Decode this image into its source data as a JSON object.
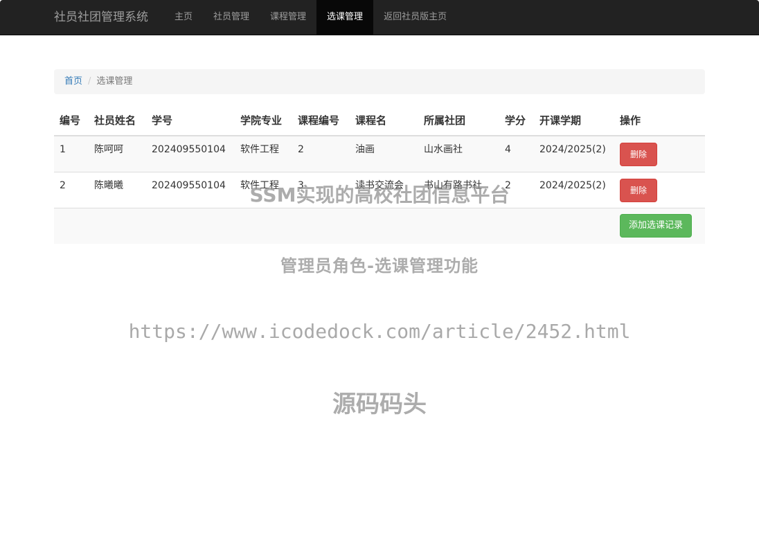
{
  "navbar": {
    "brand": "社员社团管理系统",
    "items": [
      {
        "label": "主页",
        "active": false
      },
      {
        "label": "社员管理",
        "active": false
      },
      {
        "label": "课程管理",
        "active": false
      },
      {
        "label": "选课管理",
        "active": true
      },
      {
        "label": "返回社员版主页",
        "active": false
      }
    ]
  },
  "breadcrumb": {
    "home": "首页",
    "separator": "/",
    "current": "选课管理"
  },
  "table": {
    "headers": [
      "编号",
      "社员姓名",
      "学号",
      "学院专业",
      "课程编号",
      "课程名",
      "所属社团",
      "学分",
      "开课学期",
      "操作"
    ],
    "rows": [
      {
        "id": "1",
        "name": "陈呵呵",
        "student_no": "202409550104",
        "major": "软件工程",
        "course_no": "2",
        "course_name": "油画",
        "club": "山水画社",
        "credit": "4",
        "term": "2024/2025(2)",
        "action": "删除"
      },
      {
        "id": "2",
        "name": "陈曦曦",
        "student_no": "202409550104",
        "major": "软件工程",
        "course_no": "3",
        "course_name": "读书交流会",
        "club": "书山有路书社",
        "credit": "2",
        "term": "2024/2025(2)",
        "action": "删除"
      }
    ],
    "add_button": "添加选课记录"
  },
  "watermark": {
    "line1": "SSM实现的高校社团信息平台",
    "line2": "管理员角色-选课管理功能",
    "line3": "https://www.icodedock.com/article/2452.html",
    "line4": "源码码头"
  },
  "colors": {
    "navbar_bg": "#222222",
    "danger": "#d9534f",
    "success": "#5cb85c",
    "link": "#337ab7"
  }
}
